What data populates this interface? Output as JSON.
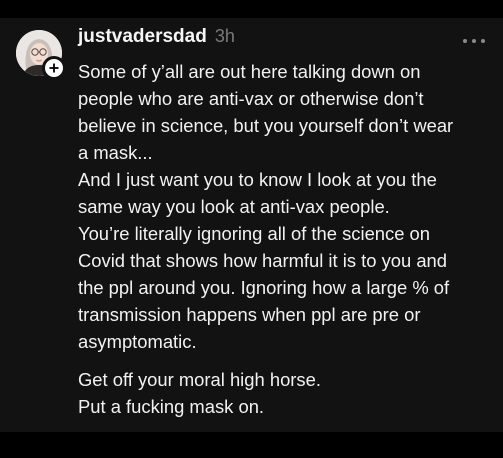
{
  "post": {
    "username": "justvadersdad",
    "timestamp": "3h",
    "avatar_icon": "user-avatar-icon",
    "add_icon": "plus-icon",
    "more_icon": "more-horizontal-icon",
    "paragraphs": [
      "Some of y’all are out here talking down on\npeople who are anti-vax or otherwise don’t\nbelieve in science, but you yourself don’t wear\na mask...",
      "And I just want you to know I look at you the\nsame way you look at anti-vax people.",
      "You’re literally ignoring all of the science on\nCovid that shows how harmful it is to you and\nthe ppl around you. Ignoring how a large % of\ntransmission happens when ppl are pre or\nasymptomatic.",
      "Get off your moral high horse.\nPut a fucking mask on."
    ]
  },
  "colors": {
    "page_background": "#000000",
    "post_background": "#121212",
    "text": "#f2f2f2",
    "muted": "#7a7a7a"
  }
}
